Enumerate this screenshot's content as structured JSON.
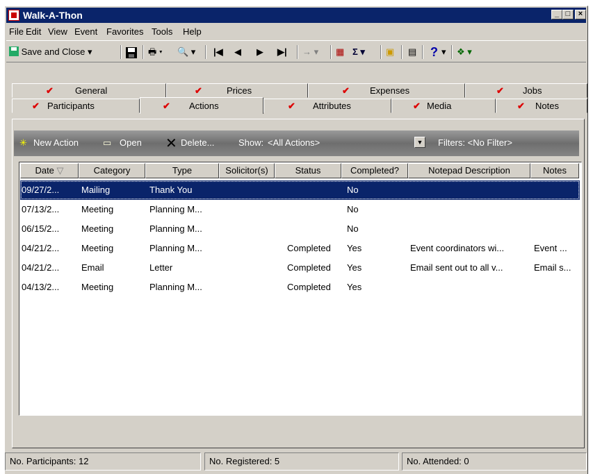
{
  "window": {
    "title": "Walk-A-Thon"
  },
  "menu": [
    "File",
    "Edit",
    "View",
    "Event",
    "Favorites",
    "Tools",
    "Help"
  ],
  "toolbar": {
    "save_close_label": "Save and Close"
  },
  "tabs_back": [
    {
      "label": "General"
    },
    {
      "label": "Prices"
    },
    {
      "label": "Expenses"
    },
    {
      "label": "Jobs"
    }
  ],
  "tabs_front": [
    {
      "label": "Participants"
    },
    {
      "label": "Actions"
    },
    {
      "label": "Attributes"
    },
    {
      "label": "Media"
    },
    {
      "label": "Notes"
    }
  ],
  "actions_bar": {
    "new_action": "New Action",
    "open": "Open",
    "delete": "Delete...",
    "show_label": "Show:",
    "show_value": "<All Actions>",
    "filters": "Filters: <No Filter>"
  },
  "table": {
    "columns": [
      "Date",
      "Category",
      "Type",
      "Solicitor(s)",
      "Status",
      "Completed?",
      "Notepad Description",
      "Notes"
    ],
    "rows": [
      [
        "09/27/2...",
        "Mailing",
        "Thank You",
        "",
        "",
        "No",
        "",
        ""
      ],
      [
        "07/13/2...",
        "Meeting",
        "Planning M...",
        "",
        "",
        "No",
        "",
        ""
      ],
      [
        "06/15/2...",
        "Meeting",
        "Planning M...",
        "",
        "",
        "No",
        "",
        ""
      ],
      [
        "04/21/2...",
        "Meeting",
        "Planning M...",
        "",
        "Completed",
        "Yes",
        "Event coordinators wi...",
        "Event ..."
      ],
      [
        "04/21/2...",
        "Email",
        "Letter",
        "",
        "Completed",
        "Yes",
        "Email sent out to all v...",
        "Email s..."
      ],
      [
        "04/13/2...",
        "Meeting",
        "Planning M...",
        "",
        "Completed",
        "Yes",
        "",
        ""
      ]
    ]
  },
  "status_bar": {
    "participants": "No. Participants: 12",
    "registered": "No. Registered: 5",
    "attended": "No. Attended: 0"
  }
}
